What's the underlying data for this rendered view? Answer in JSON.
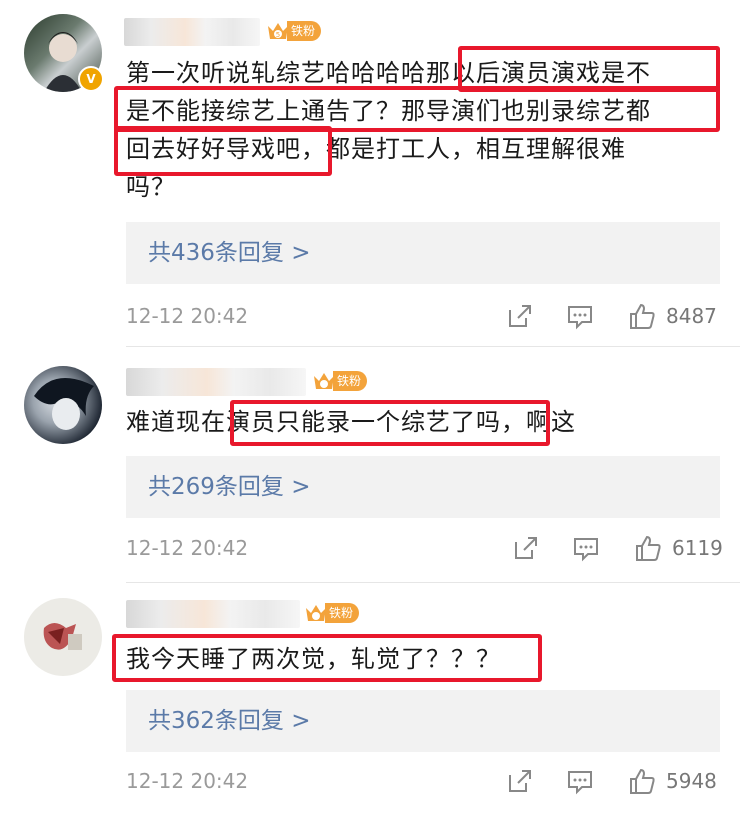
{
  "fan_badge_label": "铁粉",
  "verified_mark": "V",
  "comments": [
    {
      "text_lines": [
        "第一次听说轧综艺哈哈哈哈那以后演员演戏是不",
        "是不能接综艺上通告了？那导演们也别录综艺都",
        "回去好好导戏吧，都是打工人，相互理解很难",
        "吗？"
      ],
      "highlighted": [
        "那以后演员演戏是不",
        "是不能接综艺上通告了？那导演们也别录综艺都",
        "回去好好导戏吧"
      ],
      "replies": "共436条回复 >",
      "time": "12-12 20:42",
      "likes": "8487"
    },
    {
      "text_lines": [
        "难道现在演员只能录一个综艺了吗，啊这"
      ],
      "highlighted": [
        "演员只能录一个综艺了吗，"
      ],
      "replies": "共269条回复 >",
      "time": "12-12 20:42",
      "likes": "6119"
    },
    {
      "text_lines": [
        "我今天睡了两次觉，轧觉了？？？"
      ],
      "highlighted": [
        "我今天睡了两次觉，轧觉了？？？"
      ],
      "replies": "共362条回复 >",
      "time": "12-12 20:42",
      "likes": "5948"
    }
  ],
  "icons": [
    "share-icon",
    "comment-icon",
    "like-icon",
    "fan-crown-icon"
  ],
  "colors": {
    "highlight": "#e8182c",
    "reply_link": "#5b7aa8",
    "fan_badge": "#f3a33b",
    "timestamp": "#9a9a9a"
  }
}
